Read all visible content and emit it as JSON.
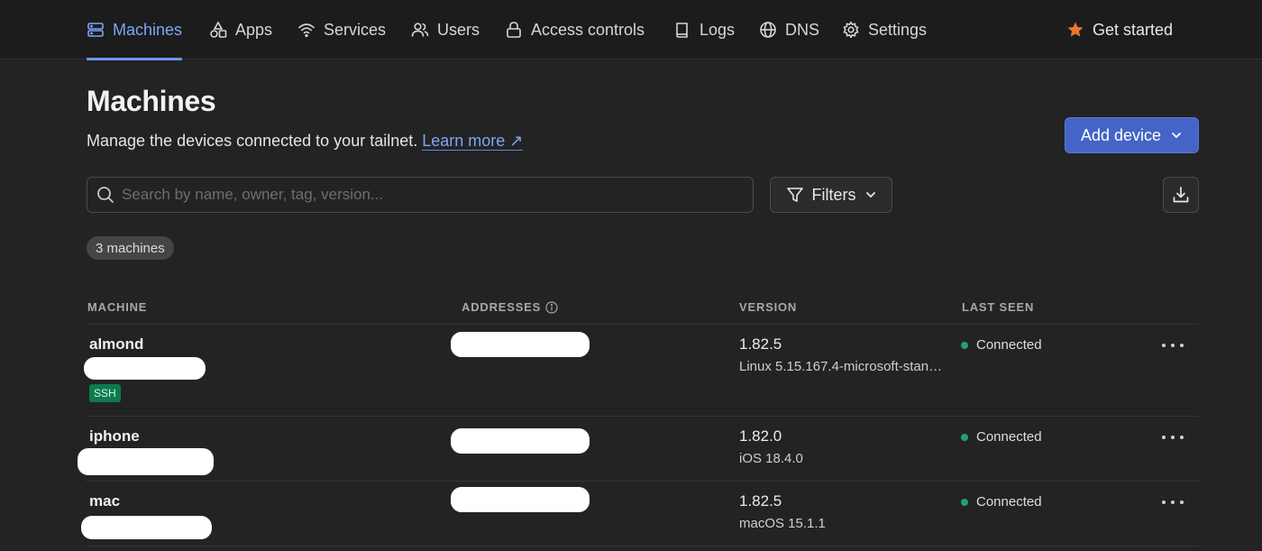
{
  "nav": {
    "machines": "Machines",
    "apps": "Apps",
    "services": "Services",
    "users": "Users",
    "access_controls": "Access controls",
    "logs": "Logs",
    "dns": "DNS",
    "settings": "Settings",
    "get_started": "Get started"
  },
  "header": {
    "title": "Machines",
    "subtitle": "Manage the devices connected to your tailnet.",
    "learn_more": "Learn more ↗",
    "add_device": "Add device"
  },
  "search": {
    "placeholder": "Search by name, owner, tag, version..."
  },
  "filters_label": "Filters",
  "machine_count": "3 machines",
  "table": {
    "columns": {
      "machine": "MACHINE",
      "addresses": "ADDRESSES",
      "version": "VERSION",
      "last_seen": "LAST SEEN"
    },
    "rows": [
      {
        "name": "almond",
        "tag": "SSH",
        "version": "1.82.5",
        "os": "Linux 5.15.167.4-microsoft-stan…",
        "status": "Connected"
      },
      {
        "name": "iphone",
        "version": "1.82.0",
        "os": "iOS 18.4.0",
        "status": "Connected"
      },
      {
        "name": "mac",
        "version": "1.82.5",
        "os": "macOS 15.1.1",
        "status": "Connected"
      }
    ]
  },
  "colors": {
    "accent": "#7ea6f5",
    "primary_button": "#4464c7",
    "connected": "#1fa36a",
    "ssh_tag": "#0d7a4f",
    "star": "#e8782a"
  }
}
